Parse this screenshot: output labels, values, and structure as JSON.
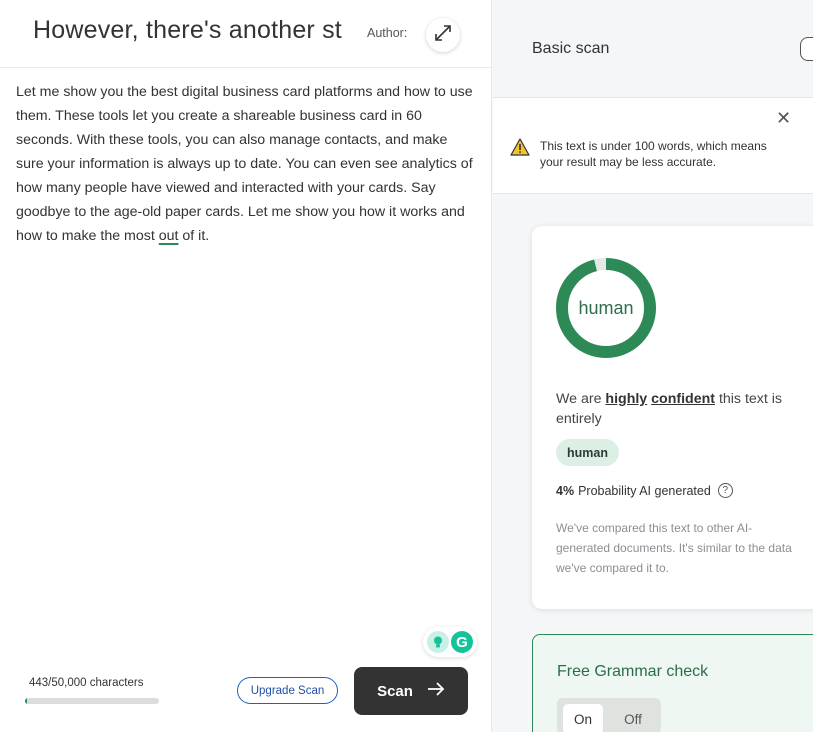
{
  "editor": {
    "title": "However, there's another st",
    "author_label": "Author:",
    "body_main": "Let me show you the best digital business card platforms and how to use them. These tools let you create a shareable business card in 60 seconds. With these tools, you can also manage contacts, and make sure your information is always up to date. You can even see analytics of how many people have viewed and interacted with your cards. Say goodbye to the age-old paper cards. Let me show you how it works and how to make the most ",
    "body_underlined": "out",
    "body_end": " of it.",
    "char_count": "443/50,000 characters",
    "char_progress": 0.00886,
    "upgrade_label": "Upgrade Scan",
    "scan_label": "Scan"
  },
  "results": {
    "title": "Basic scan",
    "warning": "This text is under 100 words, which means your result may be less accurate.",
    "donut_label": "human",
    "human_fraction": 0.96,
    "confidence_prefix": "We are ",
    "confidence_word1": "highly",
    "confidence_word2": "confident",
    "confidence_suffix": " this text is entirely",
    "badge": "human",
    "prob_pct": "4%",
    "prob_label": "Probability AI generated",
    "compare_note": "We've compared this text to other AI-generated documents. It's similar to the data we've compared it to.",
    "grammar_title": "Free Grammar check",
    "toggle_on": "On",
    "toggle_off": "Off"
  },
  "colors": {
    "accent_green": "#2d8a57",
    "donut_track": "#e6e8e7",
    "scan_button": "#333333",
    "upgrade_blue": "#1f5fbf",
    "warning_yellow": "#f2c230"
  },
  "icons": {
    "expand": "expand-arrows-icon",
    "warning": "warning-triangle-icon",
    "close": "close-icon",
    "scan_arrow": "arrow-right-icon",
    "help": "question-circle-icon",
    "bulb": "lightbulb-icon",
    "grammarly": "grammarly-g-icon"
  }
}
